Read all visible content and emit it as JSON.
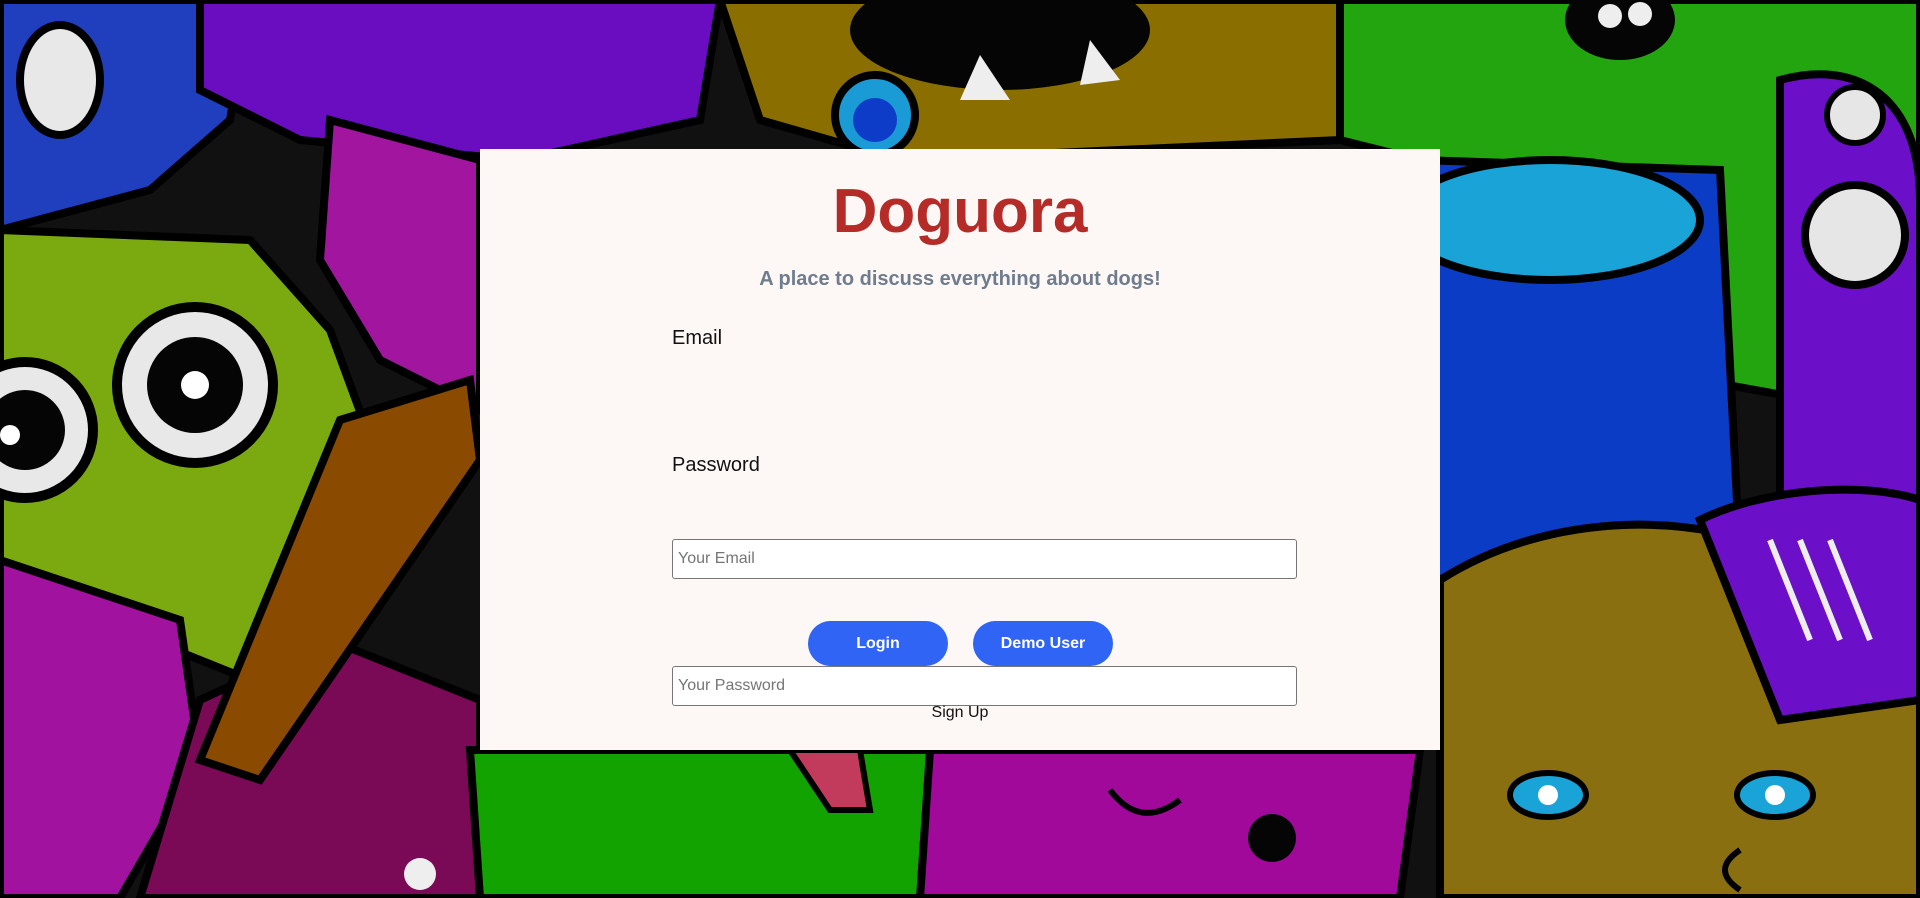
{
  "app": {
    "title": "Doguora",
    "tagline": "A place to discuss everything about dogs!"
  },
  "form": {
    "email_label": "Email",
    "email_placeholder": "Your Email",
    "email_value": "",
    "password_label": "Password",
    "password_placeholder": "Your Password",
    "password_value": ""
  },
  "actions": {
    "login_label": "Login",
    "demo_label": "Demo User",
    "signup_label": "Sign Up"
  },
  "colors": {
    "title": "#b52b27",
    "tagline": "#6e7c8e",
    "button": "#2f64f5",
    "card": "#fdf8f6"
  },
  "background": {
    "description_icon": "cartoon-monsters-background"
  }
}
